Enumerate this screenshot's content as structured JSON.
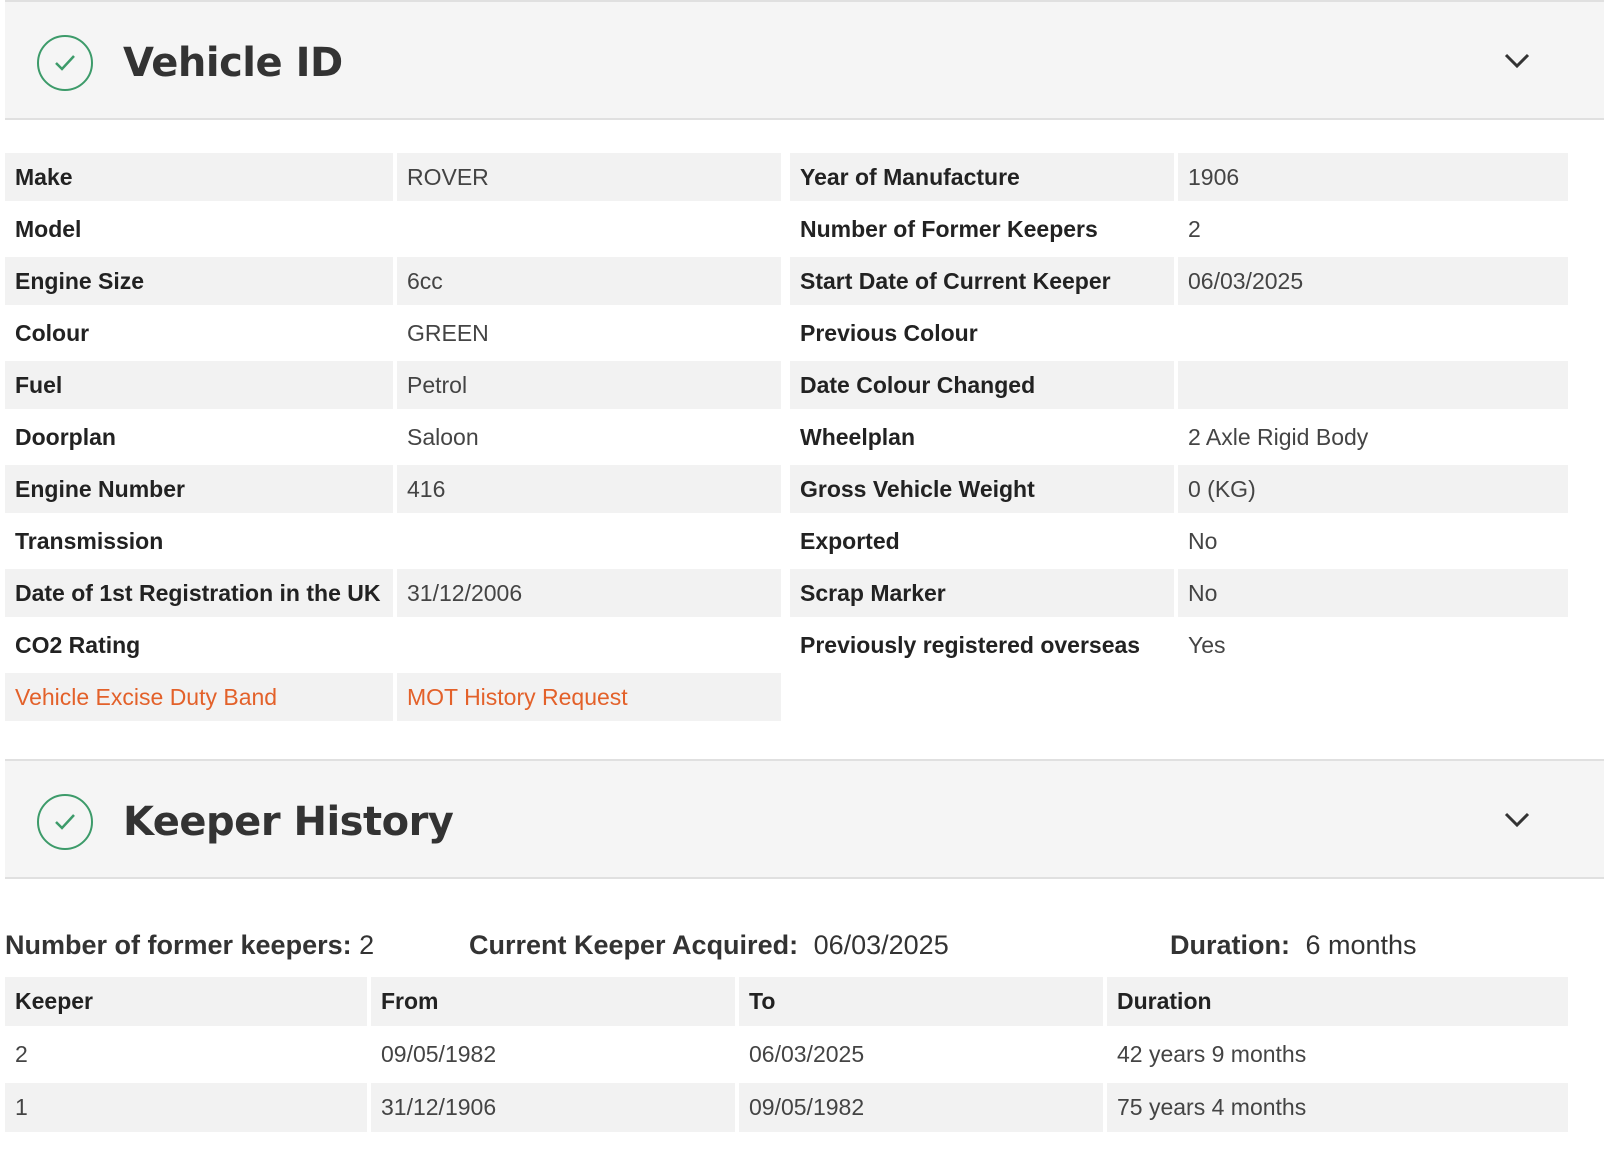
{
  "vehicle_id": {
    "title": "Vehicle ID",
    "left": [
      {
        "label": "Make",
        "value": "ROVER"
      },
      {
        "label": "Model",
        "value": ""
      },
      {
        "label": "Engine Size",
        "value": "6cc"
      },
      {
        "label": "Colour",
        "value": "GREEN"
      },
      {
        "label": "Fuel",
        "value": "Petrol"
      },
      {
        "label": "Doorplan",
        "value": "Saloon"
      },
      {
        "label": "Engine Number",
        "value": "416"
      },
      {
        "label": "Transmission",
        "value": ""
      },
      {
        "label": "Date of 1st Registration in the UK",
        "value": "31/12/2006"
      },
      {
        "label": "CO2 Rating",
        "value": ""
      }
    ],
    "links": {
      "excise": "Vehicle Excise Duty Band",
      "mot": "MOT History Request"
    },
    "right": [
      {
        "label": "Year of Manufacture",
        "value": "1906"
      },
      {
        "label": "Number of Former Keepers",
        "value": "2"
      },
      {
        "label": "Start Date of Current Keeper",
        "value": "06/03/2025"
      },
      {
        "label": "Previous Colour",
        "value": ""
      },
      {
        "label": "Date Colour Changed",
        "value": ""
      },
      {
        "label": "Wheelplan",
        "value": "2 Axle Rigid Body"
      },
      {
        "label": "Gross Vehicle Weight",
        "value": "0 (KG)"
      },
      {
        "label": "Exported",
        "value": "No"
      },
      {
        "label": "Scrap Marker",
        "value": "No"
      },
      {
        "label": "Previously registered overseas",
        "value": "Yes"
      }
    ]
  },
  "keeper_history": {
    "title": "Keeper History",
    "summary": {
      "former_label": "Number of former keepers:",
      "former_value": "2",
      "acquired_label": "Current Keeper Acquired:",
      "acquired_value": "06/03/2025",
      "duration_label": "Duration:",
      "duration_value": "6 months"
    },
    "columns": [
      "Keeper",
      "From",
      "To",
      "Duration"
    ],
    "rows": [
      [
        "2",
        "09/05/1982",
        "06/03/2025",
        "42 years 9 months"
      ],
      [
        "1",
        "31/12/1906",
        "09/05/1982",
        "75 years 4 months"
      ]
    ]
  },
  "colors": {
    "accent_link": "#e3612a",
    "check_green": "#3d9b6a",
    "row_shade": "#f2f2f2"
  }
}
